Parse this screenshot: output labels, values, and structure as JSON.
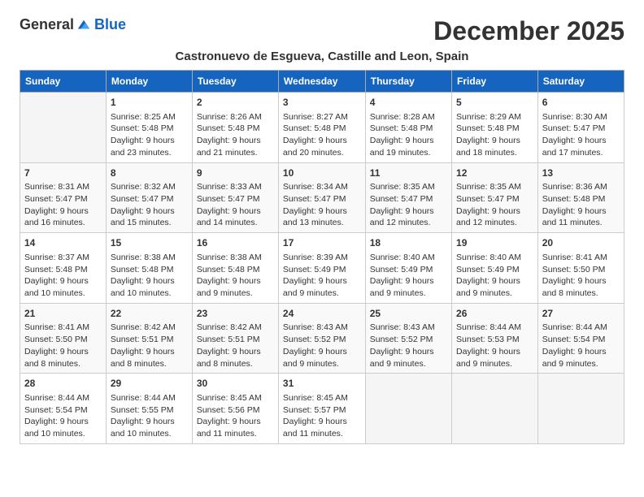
{
  "header": {
    "logo_general": "General",
    "logo_blue": "Blue",
    "month_title": "December 2025",
    "subtitle": "Castronuevo de Esgueva, Castille and Leon, Spain"
  },
  "days_of_week": [
    "Sunday",
    "Monday",
    "Tuesday",
    "Wednesday",
    "Thursday",
    "Friday",
    "Saturday"
  ],
  "weeks": [
    [
      {
        "day": "",
        "info": ""
      },
      {
        "day": "1",
        "info": "Sunrise: 8:25 AM\nSunset: 5:48 PM\nDaylight: 9 hours\nand 23 minutes."
      },
      {
        "day": "2",
        "info": "Sunrise: 8:26 AM\nSunset: 5:48 PM\nDaylight: 9 hours\nand 21 minutes."
      },
      {
        "day": "3",
        "info": "Sunrise: 8:27 AM\nSunset: 5:48 PM\nDaylight: 9 hours\nand 20 minutes."
      },
      {
        "day": "4",
        "info": "Sunrise: 8:28 AM\nSunset: 5:48 PM\nDaylight: 9 hours\nand 19 minutes."
      },
      {
        "day": "5",
        "info": "Sunrise: 8:29 AM\nSunset: 5:48 PM\nDaylight: 9 hours\nand 18 minutes."
      },
      {
        "day": "6",
        "info": "Sunrise: 8:30 AM\nSunset: 5:47 PM\nDaylight: 9 hours\nand 17 minutes."
      }
    ],
    [
      {
        "day": "7",
        "info": "Sunrise: 8:31 AM\nSunset: 5:47 PM\nDaylight: 9 hours\nand 16 minutes."
      },
      {
        "day": "8",
        "info": "Sunrise: 8:32 AM\nSunset: 5:47 PM\nDaylight: 9 hours\nand 15 minutes."
      },
      {
        "day": "9",
        "info": "Sunrise: 8:33 AM\nSunset: 5:47 PM\nDaylight: 9 hours\nand 14 minutes."
      },
      {
        "day": "10",
        "info": "Sunrise: 8:34 AM\nSunset: 5:47 PM\nDaylight: 9 hours\nand 13 minutes."
      },
      {
        "day": "11",
        "info": "Sunrise: 8:35 AM\nSunset: 5:47 PM\nDaylight: 9 hours\nand 12 minutes."
      },
      {
        "day": "12",
        "info": "Sunrise: 8:35 AM\nSunset: 5:47 PM\nDaylight: 9 hours\nand 12 minutes."
      },
      {
        "day": "13",
        "info": "Sunrise: 8:36 AM\nSunset: 5:48 PM\nDaylight: 9 hours\nand 11 minutes."
      }
    ],
    [
      {
        "day": "14",
        "info": "Sunrise: 8:37 AM\nSunset: 5:48 PM\nDaylight: 9 hours\nand 10 minutes."
      },
      {
        "day": "15",
        "info": "Sunrise: 8:38 AM\nSunset: 5:48 PM\nDaylight: 9 hours\nand 10 minutes."
      },
      {
        "day": "16",
        "info": "Sunrise: 8:38 AM\nSunset: 5:48 PM\nDaylight: 9 hours\nand 9 minutes."
      },
      {
        "day": "17",
        "info": "Sunrise: 8:39 AM\nSunset: 5:49 PM\nDaylight: 9 hours\nand 9 minutes."
      },
      {
        "day": "18",
        "info": "Sunrise: 8:40 AM\nSunset: 5:49 PM\nDaylight: 9 hours\nand 9 minutes."
      },
      {
        "day": "19",
        "info": "Sunrise: 8:40 AM\nSunset: 5:49 PM\nDaylight: 9 hours\nand 9 minutes."
      },
      {
        "day": "20",
        "info": "Sunrise: 8:41 AM\nSunset: 5:50 PM\nDaylight: 9 hours\nand 8 minutes."
      }
    ],
    [
      {
        "day": "21",
        "info": "Sunrise: 8:41 AM\nSunset: 5:50 PM\nDaylight: 9 hours\nand 8 minutes."
      },
      {
        "day": "22",
        "info": "Sunrise: 8:42 AM\nSunset: 5:51 PM\nDaylight: 9 hours\nand 8 minutes."
      },
      {
        "day": "23",
        "info": "Sunrise: 8:42 AM\nSunset: 5:51 PM\nDaylight: 9 hours\nand 8 minutes."
      },
      {
        "day": "24",
        "info": "Sunrise: 8:43 AM\nSunset: 5:52 PM\nDaylight: 9 hours\nand 9 minutes."
      },
      {
        "day": "25",
        "info": "Sunrise: 8:43 AM\nSunset: 5:52 PM\nDaylight: 9 hours\nand 9 minutes."
      },
      {
        "day": "26",
        "info": "Sunrise: 8:44 AM\nSunset: 5:53 PM\nDaylight: 9 hours\nand 9 minutes."
      },
      {
        "day": "27",
        "info": "Sunrise: 8:44 AM\nSunset: 5:54 PM\nDaylight: 9 hours\nand 9 minutes."
      }
    ],
    [
      {
        "day": "28",
        "info": "Sunrise: 8:44 AM\nSunset: 5:54 PM\nDaylight: 9 hours\nand 10 minutes."
      },
      {
        "day": "29",
        "info": "Sunrise: 8:44 AM\nSunset: 5:55 PM\nDaylight: 9 hours\nand 10 minutes."
      },
      {
        "day": "30",
        "info": "Sunrise: 8:45 AM\nSunset: 5:56 PM\nDaylight: 9 hours\nand 11 minutes."
      },
      {
        "day": "31",
        "info": "Sunrise: 8:45 AM\nSunset: 5:57 PM\nDaylight: 9 hours\nand 11 minutes."
      },
      {
        "day": "",
        "info": ""
      },
      {
        "day": "",
        "info": ""
      },
      {
        "day": "",
        "info": ""
      }
    ]
  ]
}
